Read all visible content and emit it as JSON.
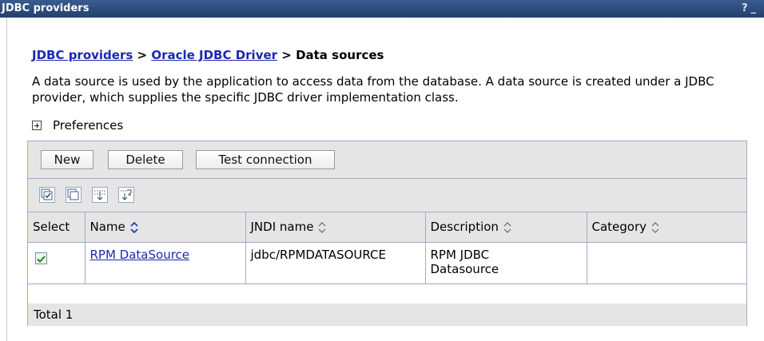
{
  "window": {
    "title": "JDBC providers",
    "help": "?",
    "minimize": "_"
  },
  "breadcrumb": {
    "link1": "JDBC providers",
    "sep1": " > ",
    "link2": "Oracle JDBC Driver",
    "sep2": " > ",
    "current": "Data sources"
  },
  "description": "A data source is used by the application to access data from the database. A data source is created under a JDBC provider, which supplies the specific JDBC driver implementation class.",
  "preferences": {
    "label": "Preferences"
  },
  "buttons": {
    "new": "New",
    "delete": "Delete",
    "test": "Test connection"
  },
  "icon_toolbar": [
    "select-all-icon",
    "deselect-all-icon",
    "show-filter-icon",
    "clear-filter-icon"
  ],
  "table": {
    "headers": {
      "select": "Select",
      "name": "Name",
      "jndi": "JNDI name",
      "description": "Description",
      "category": "Category"
    },
    "rows": [
      {
        "selected": true,
        "name": "RPM DataSource",
        "jndi": "jdbc/RPMDATASOURCE",
        "description": "RPM JDBC Datasource",
        "category": ""
      }
    ],
    "total": "Total 1"
  },
  "colors": {
    "title_bar": "#2d4a7a",
    "link": "#1c28b0",
    "toolbar_bg": "#e5e5e5",
    "border": "#a7a7c8"
  }
}
